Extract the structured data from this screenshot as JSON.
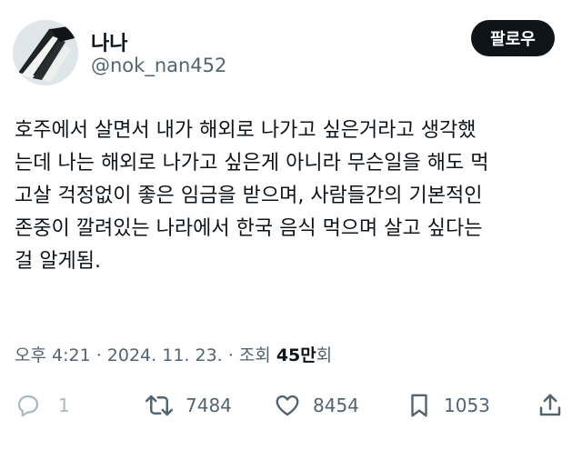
{
  "author": {
    "display_name": "나나",
    "handle": "@nok_nan452",
    "follow_label": "팔로우"
  },
  "tweet": {
    "lines": [
      "호주에서 살면서 내가 해외로 나가고 싶은거라고 생각했",
      "는데 나는 해외로 나가고 싶은게 아니라 무슨일을 해도 먹",
      "고살 걱정없이 좋은 임금을 받으며, 사람들간의 기본적인",
      "존중이 깔려있는 나라에서 한국 음식 먹으며 살고 싶다는",
      "걸 알게됨."
    ]
  },
  "meta": {
    "time": "오후 4:21",
    "separator1": " · ",
    "date": "2024. 11. 23.",
    "separator2": " · ",
    "views_prefix": "조회 ",
    "views_count": "45만",
    "views_suffix": "회"
  },
  "actions": {
    "reply_count": "1",
    "retweet_count": "7484",
    "like_count": "8454",
    "bookmark_count": "1053"
  },
  "icons": {
    "reply": "reply-icon",
    "retweet": "retweet-icon",
    "like": "heart-icon",
    "bookmark": "bookmark-icon",
    "share": "share-icon"
  },
  "colors": {
    "text": "#0f1419",
    "secondary": "#536471",
    "disabled": "#aab8c2",
    "button_bg": "#0f1419"
  }
}
